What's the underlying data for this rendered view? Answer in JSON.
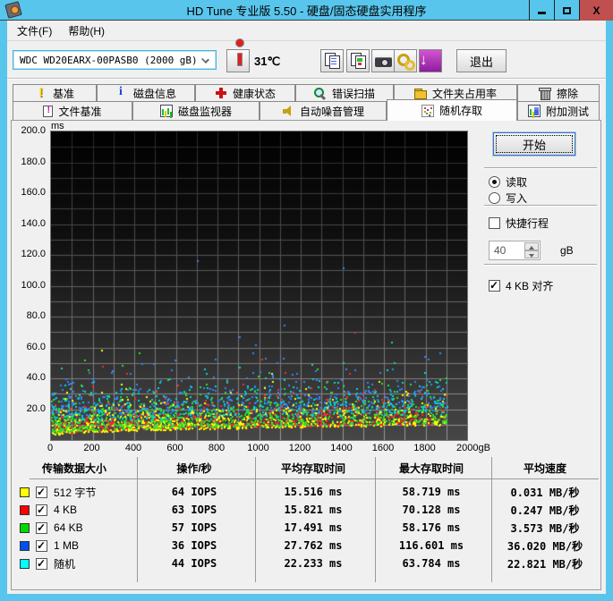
{
  "window": {
    "title": "HD Tune 专业版 5.50 - 硬盘/固态硬盘实用程序",
    "close_glyph": "X"
  },
  "menu": {
    "items": [
      {
        "id": "file",
        "label": "文件(F)"
      },
      {
        "id": "help",
        "label": "帮助(H)"
      }
    ]
  },
  "toolbar": {
    "drive_selected": "WDC WD20EARX-00PASB0 (2000 gB)",
    "temperature": "31℃",
    "exit_label": "退出",
    "icons": [
      "thermometer-icon",
      "copy-text-icon",
      "copy-image-icon",
      "camera-icon",
      "gold-keys-icon",
      "download-arrow-icon"
    ]
  },
  "tabs": {
    "row1": [
      {
        "id": "benchmark",
        "label": "基准",
        "icon": "benchmark-icon"
      },
      {
        "id": "disk-info",
        "label": "磁盘信息",
        "icon": "info-icon"
      },
      {
        "id": "health",
        "label": "健康状态",
        "icon": "health-icon"
      },
      {
        "id": "error-scan",
        "label": "错误扫描",
        "icon": "error-scan-icon"
      },
      {
        "id": "folder-usage",
        "label": "文件夹占用率",
        "icon": "folder-icon"
      },
      {
        "id": "erase",
        "label": "擦除",
        "icon": "erase-icon"
      }
    ],
    "row2": [
      {
        "id": "file-benchmark",
        "label": "文件基准",
        "icon": "file-benchmark-icon"
      },
      {
        "id": "disk-monitor",
        "label": "磁盘监视器",
        "icon": "disk-monitor-icon"
      },
      {
        "id": "aam",
        "label": "自动噪音管理",
        "icon": "speaker-icon"
      },
      {
        "id": "random-access",
        "label": "随机存取",
        "icon": "random-access-icon",
        "active": true
      },
      {
        "id": "extra-tests",
        "label": "附加测试",
        "icon": "extra-tests-icon"
      }
    ]
  },
  "panel": {
    "start_label": "开始",
    "mode_read": "读取",
    "mode_write": "写入",
    "mode_selected": "读取",
    "short_stroke_label": "快捷行程",
    "short_stroke_checked": false,
    "short_stroke_value": "40",
    "short_stroke_unit": "gB",
    "align_label": "4 KB 对齐",
    "align_checked": true
  },
  "chart_data": {
    "type": "scatter",
    "title": "随机存取 access time vs disk position",
    "xlabel": "gB",
    "ylabel": "ms",
    "xlim": [
      0,
      2000
    ],
    "ylim": [
      0,
      200
    ],
    "grid": {
      "x_step": 100,
      "y_step": 10
    },
    "x_tick_values": [
      0,
      200,
      400,
      600,
      800,
      1000,
      1200,
      1400,
      1600,
      1800,
      2000
    ],
    "x_tick_labels": [
      "0",
      "200",
      "400",
      "600",
      "800",
      "1000",
      "1200",
      "1400",
      "1600",
      "1800",
      "2000gB"
    ],
    "y_tick_values": [
      200,
      180,
      160,
      140,
      120,
      100,
      80,
      60,
      40,
      20
    ],
    "y_tick_labels": [
      "200.0",
      "180.0",
      "160.0",
      "140.0",
      "120.0",
      "100.0",
      "80.0",
      "60.0",
      "40.0",
      "20.0"
    ],
    "seed": 1234,
    "x_max_data": 1900,
    "envelope": {
      "base": 3.2,
      "rise": 6.8
    },
    "series": [
      {
        "name": "512 字节",
        "color": "#ffff00",
        "z": 4,
        "count": 700,
        "y_offset": 0,
        "y_spread": 5.6,
        "y_cap": 45,
        "iops": 64,
        "avg_ms": 15.516,
        "max_ms": 58.719,
        "avg_speed_mb_s": 0.031
      },
      {
        "name": "4 KB",
        "color": "#ff2a2a",
        "z": 3,
        "count": 700,
        "y_offset": 0.5,
        "y_spread": 5.8,
        "y_cap": 50,
        "iops": 63,
        "avg_ms": 15.821,
        "max_ms": 70.128,
        "avg_speed_mb_s": 0.247
      },
      {
        "name": "64 KB",
        "color": "#2ce02c",
        "z": 5,
        "count": 700,
        "y_offset": 1.2,
        "y_spread": 6.6,
        "y_cap": 50,
        "iops": 57,
        "avg_ms": 17.491,
        "max_ms": 58.176,
        "avg_speed_mb_s": 3.573
      },
      {
        "name": "1 MB",
        "color": "#2e86ff",
        "z": 1,
        "count": 470,
        "y_offset": 12,
        "y_spread": 8,
        "y_cap": 58,
        "iops": 36,
        "avg_ms": 27.762,
        "max_ms": 116.601,
        "avg_speed_mb_s": 36.02
      },
      {
        "name": "随机",
        "color": "#00d8d8",
        "z": 2,
        "count": 520,
        "y_offset": 7,
        "y_spread": 8,
        "y_cap": 52,
        "iops": 44,
        "avg_ms": 22.233,
        "max_ms": 63.784,
        "avg_speed_mb_s": 22.821
      }
    ],
    "outliers": [
      {
        "series": "1 MB",
        "x": 700,
        "y": 116.6
      },
      {
        "series": "1 MB",
        "x": 1400,
        "y": 112
      },
      {
        "series": "1 MB",
        "x": 1120,
        "y": 75
      },
      {
        "series": "1 MB",
        "x": 905,
        "y": 67
      },
      {
        "series": "1 MB",
        "x": 980,
        "y": 62
      },
      {
        "series": "4 KB",
        "x": 1460,
        "y": 70.1
      },
      {
        "series": "4 KB",
        "x": 1010,
        "y": 53
      },
      {
        "series": "64 KB",
        "x": 420,
        "y": 57
      },
      {
        "series": "64 KB",
        "x": 160,
        "y": 52
      },
      {
        "series": "随机",
        "x": 1635,
        "y": 63.8
      },
      {
        "series": "512 字节",
        "x": 240,
        "y": 58.7
      }
    ]
  },
  "table": {
    "headers": [
      "传输数据大小",
      "操作/秒",
      "平均存取时间",
      "最大存取时间",
      "平均速度"
    ],
    "rows": [
      {
        "swatch": "#ffff00",
        "checked": true,
        "label": "512 字节",
        "ops": "64 IOPS",
        "avg": "15.516 ms",
        "max": "58.719 ms",
        "speed": "0.031 MB/秒"
      },
      {
        "swatch": "#ff0000",
        "checked": true,
        "label": "4 KB",
        "ops": "63 IOPS",
        "avg": "15.821 ms",
        "max": "70.128 ms",
        "speed": "0.247 MB/秒"
      },
      {
        "swatch": "#00dc00",
        "checked": true,
        "label": "64 KB",
        "ops": "57 IOPS",
        "avg": "17.491 ms",
        "max": "58.176 ms",
        "speed": "3.573 MB/秒"
      },
      {
        "swatch": "#0050f0",
        "checked": true,
        "label": "1 MB",
        "ops": "36 IOPS",
        "avg": "27.762 ms",
        "max": "116.601 ms",
        "speed": "36.020 MB/秒"
      },
      {
        "swatch": "#00ffff",
        "checked": true,
        "label": "随机",
        "ops": "44 IOPS",
        "avg": "22.233 ms",
        "max": "63.784 ms",
        "speed": "22.821 MB/秒"
      }
    ]
  }
}
